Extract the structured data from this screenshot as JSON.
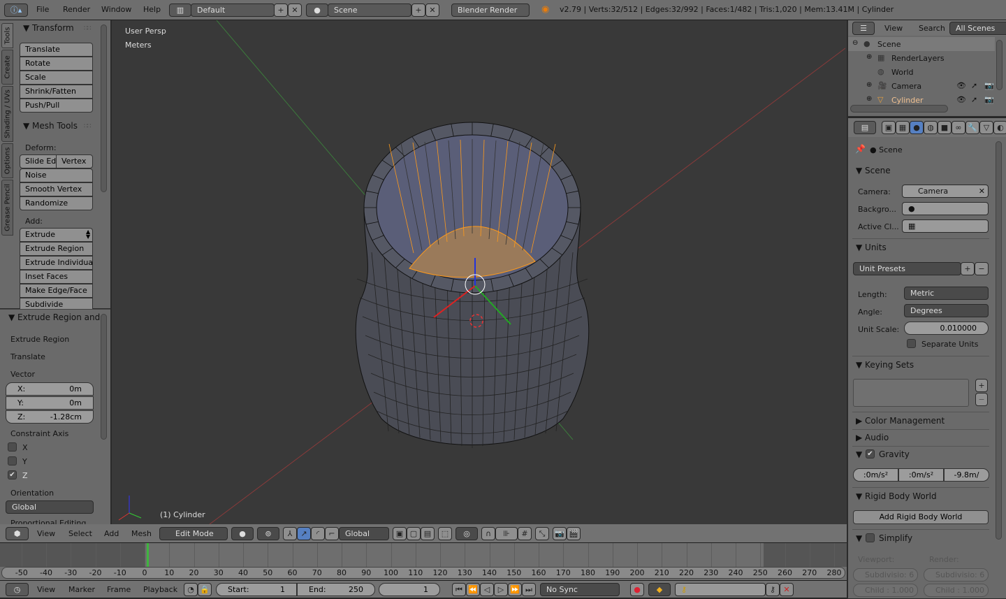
{
  "topbar": {
    "menus": [
      "File",
      "Render",
      "Window",
      "Help"
    ],
    "layout": "Default",
    "scene": "Scene",
    "engine": "Blender Render",
    "stats": "v2.79 | Verts:32/512 | Edges:32/992 | Faces:1/482 | Tris:1,020 | Mem:13.41M | Cylinder"
  },
  "tool_tabs": [
    "Tools",
    "Create",
    "Shading / UVs",
    "Options",
    "Grease Pencil"
  ],
  "tools": {
    "transform_header": "Transform",
    "transform": [
      "Translate",
      "Rotate",
      "Scale",
      "Shrink/Fatten",
      "Push/Pull"
    ],
    "mesh_tools_header": "Mesh Tools",
    "deform_label": "Deform:",
    "slide_edge": "Slide Ed",
    "vertex": "Vertex",
    "deform": [
      "Noise",
      "Smooth Vertex",
      "Randomize"
    ],
    "add_label": "Add:",
    "extrude": "Extrude",
    "add": [
      "Extrude Region",
      "Extrude Individual",
      "Inset Faces",
      "Make Edge/Face",
      "Subdivide"
    ]
  },
  "redo": {
    "header": "Extrude Region and",
    "op1": "Extrude Region",
    "op2": "Translate",
    "vector_label": "Vector",
    "vector": [
      {
        "axis": "X:",
        "value": "0m"
      },
      {
        "axis": "Y:",
        "value": "0m"
      },
      {
        "axis": "Z:",
        "value": "-1.28cm"
      }
    ],
    "constraint_label": "Constraint Axis",
    "constraint": [
      {
        "axis": "X",
        "checked": false
      },
      {
        "axis": "Y",
        "checked": false
      },
      {
        "axis": "Z",
        "checked": true
      }
    ],
    "orientation_label": "Orientation",
    "orientation": "Global",
    "proportional": "Proportional Editing"
  },
  "viewport": {
    "view_name": "User Persp",
    "units": "Meters",
    "object_label": "(1) Cylinder",
    "face_color": "#9a7a5a",
    "mesh_color": "#4a4c55",
    "selected_edge_color": "#ff9a1a"
  },
  "view_header": {
    "menus": [
      "View",
      "Select",
      "Add",
      "Mesh"
    ],
    "mode": "Edit Mode",
    "orientation": "Global"
  },
  "timeline": {
    "ticks": [
      -50,
      -40,
      -30,
      -20,
      -10,
      0,
      10,
      20,
      30,
      40,
      50,
      60,
      70,
      80,
      90,
      100,
      110,
      120,
      130,
      140,
      150,
      160,
      170,
      180,
      190,
      200,
      210,
      220,
      230,
      240,
      250,
      260,
      270,
      280
    ],
    "current_frame": 1,
    "menus": [
      "View",
      "Marker",
      "Frame",
      "Playback"
    ],
    "start_label": "Start:",
    "start": "1",
    "end_label": "End:",
    "end": "250",
    "frame": "1",
    "sync": "No Sync"
  },
  "outliner": {
    "menus": [
      "View",
      "Search"
    ],
    "filter": "All Scenes",
    "items": [
      "Scene",
      "RenderLayers",
      "World",
      "Camera",
      "Cylinder"
    ]
  },
  "properties": {
    "context": "Scene",
    "scene_header": "Scene",
    "camera_label": "Camera:",
    "camera": "Camera",
    "background_label": "Backgro...",
    "active_clip_label": "Active Cl...",
    "units_header": "Units",
    "unit_presets": "Unit Presets",
    "length_label": "Length:",
    "length": "Metric",
    "angle_label": "Angle:",
    "angle": "Degrees",
    "unit_scale_label": "Unit Scale:",
    "unit_scale": "0.010000",
    "separate_units": "Separate Units",
    "keying_header": "Keying Sets",
    "color_mgmt": "Color Management",
    "audio": "Audio",
    "gravity_header": "Gravity",
    "gravity": [
      ":0m/s²",
      ":0m/s²",
      "-9.8m/"
    ],
    "rigid_header": "Rigid Body World",
    "add_rigid": "Add Rigid Body World",
    "simplify_header": "Simplify",
    "viewport_label": "Viewport:",
    "render_label": "Render:",
    "subdiv_vp": "Subdivisio: 6",
    "subdiv_r": "Subdivisio: 6",
    "child_vp": "Child : 1.000",
    "child_r": "Child : 1.000"
  }
}
